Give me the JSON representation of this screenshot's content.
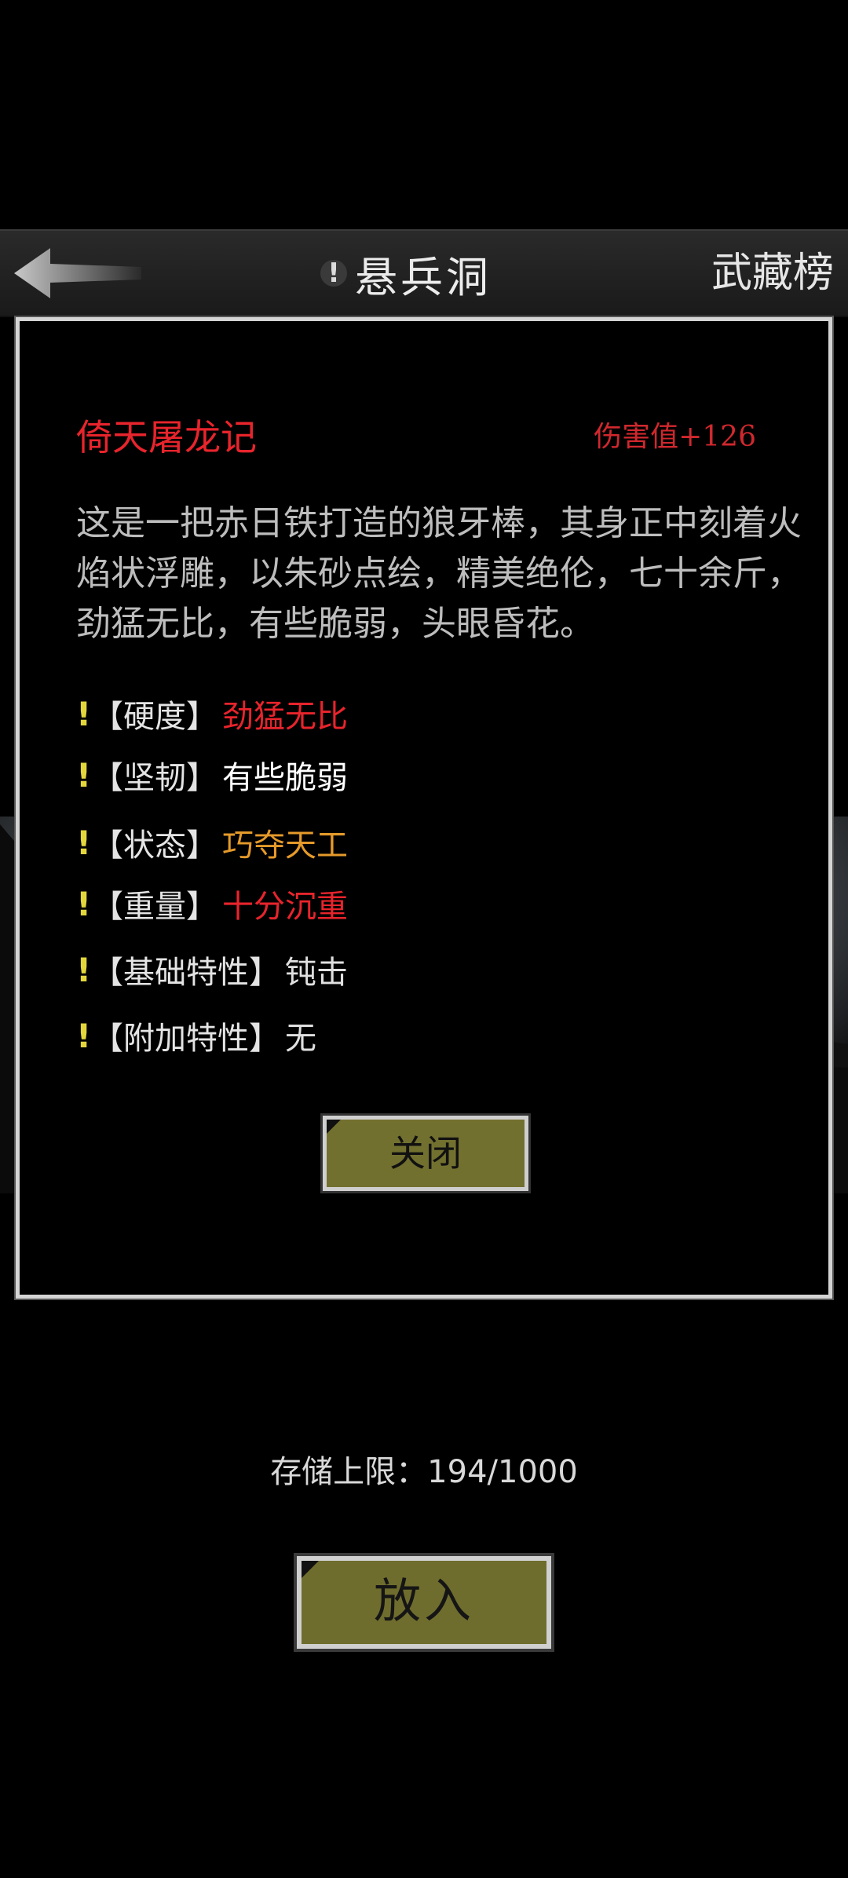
{
  "header": {
    "back_icon": "back-arrow-icon",
    "alert_mark": "!",
    "title": "悬兵洞",
    "right_link": "武藏榜"
  },
  "item": {
    "name": "倚天屠龙记",
    "damage": "伤害值+126",
    "description": "这是一把赤日铁打造的狼牙棒，其身正中刻着火焰状浮雕，以朱砂点绘，精美绝伦，七十余斤，劲猛无比，有些脆弱，头眼昏花。",
    "attributes": [
      {
        "mark": "!",
        "label": "【硬度】",
        "value": "劲猛无比",
        "color": "#e8242c"
      },
      {
        "mark": "!",
        "label": "【坚韧】",
        "value": "有些脆弱",
        "color": "#ffffff"
      },
      {
        "mark": "!",
        "label": "【状态】",
        "value": "巧夺天工",
        "color": "#e59a2a"
      },
      {
        "mark": "!",
        "label": "【重量】",
        "value": "十分沉重",
        "color": "#e8242c"
      },
      {
        "mark": "!",
        "label": "【基础特性】",
        "value": "钝击",
        "color": "#e0e0e0"
      },
      {
        "mark": "!",
        "label": "【附加特性】",
        "value": "无",
        "color": "#e0e0e0"
      }
    ],
    "close_label": "关闭"
  },
  "storage": {
    "text": "存储上限：194/1000"
  },
  "put_label": "放入",
  "colors": {
    "accent_red": "#e8242c",
    "button_olive": "#72702f",
    "alert_yellow": "#e3d63c"
  }
}
